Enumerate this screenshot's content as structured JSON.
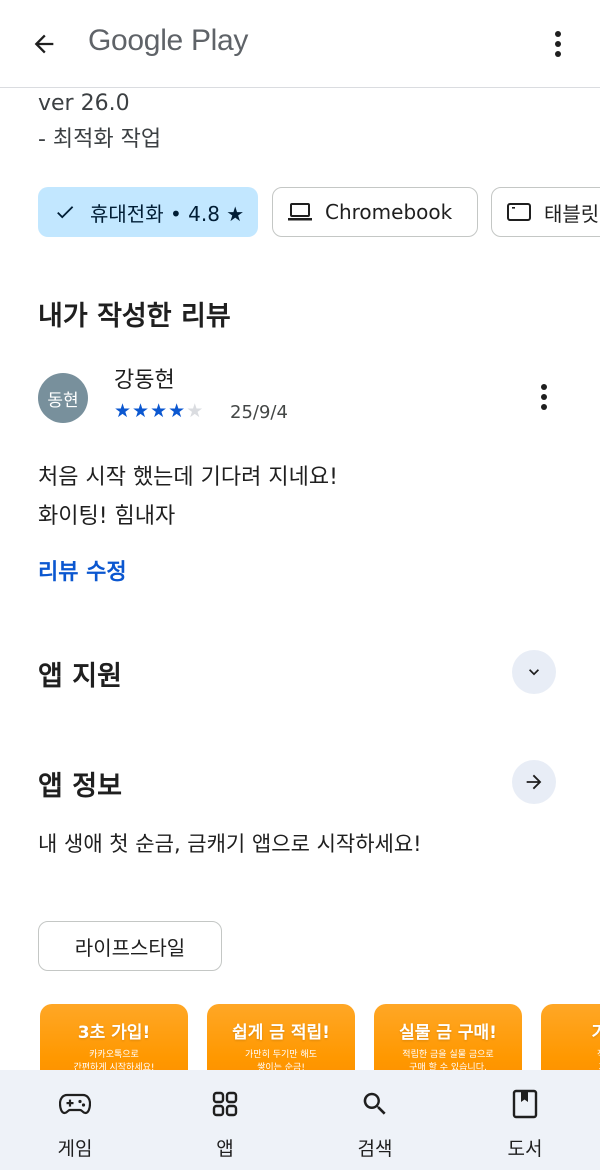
{
  "topbar": {
    "brand": "Google Play"
  },
  "whats_new": {
    "version": "ver 26.0",
    "note": "- 최적화 작업"
  },
  "device_chips": [
    {
      "label": "휴대전화 • 4.8 ★",
      "icon": "check-icon",
      "selected": true
    },
    {
      "label": "Chromebook",
      "icon": "laptop-icon",
      "selected": false
    },
    {
      "label": "태블릿",
      "icon": "tablet-icon",
      "selected": false
    }
  ],
  "my_review": {
    "section_title": "내가 작성한 리뷰",
    "avatar_text": "동현",
    "author": "강동현",
    "rating": 4,
    "max_rating": 5,
    "date": "25/9/4",
    "text_line1": "처음 시작 했는데 기다려 지네요!",
    "text_line2": "화이팅! 힘내자",
    "edit_label": "리뷰 수정"
  },
  "app_support": {
    "title": "앱 지원"
  },
  "about_app": {
    "title": "앱 정보",
    "description": "내 생애 첫 순금, 금캐기 앱으로 시작하세요!",
    "category": "라이프스타일"
  },
  "screenshots": [
    {
      "headline": "3초 가입!",
      "sub1": "카카오톡으로",
      "sub2": "간편하게 시작하세요!"
    },
    {
      "headline": "쉽게 금 적립!",
      "sub1": "가만히 두기만 해도",
      "sub2": "쌓이는 순금!"
    },
    {
      "headline": "실물 금 구매!",
      "sub1": "적립한 금을 실물 금으로",
      "sub2": "구매 할 수 있습니다."
    },
    {
      "headline": "기프티",
      "sub1": "적립한 금",
      "sub2": "기프티콘"
    }
  ],
  "bottom_nav": [
    {
      "label": "게임",
      "icon": "gamepad-icon"
    },
    {
      "label": "앱",
      "icon": "apps-grid-icon"
    },
    {
      "label": "검색",
      "icon": "search-icon"
    },
    {
      "label": "도서",
      "icon": "book-icon"
    }
  ],
  "colors": {
    "accent": "#0b57d0",
    "chip_selected": "#c2e7ff",
    "nav_bg": "#eef2f8",
    "avatar": "#78909c"
  }
}
